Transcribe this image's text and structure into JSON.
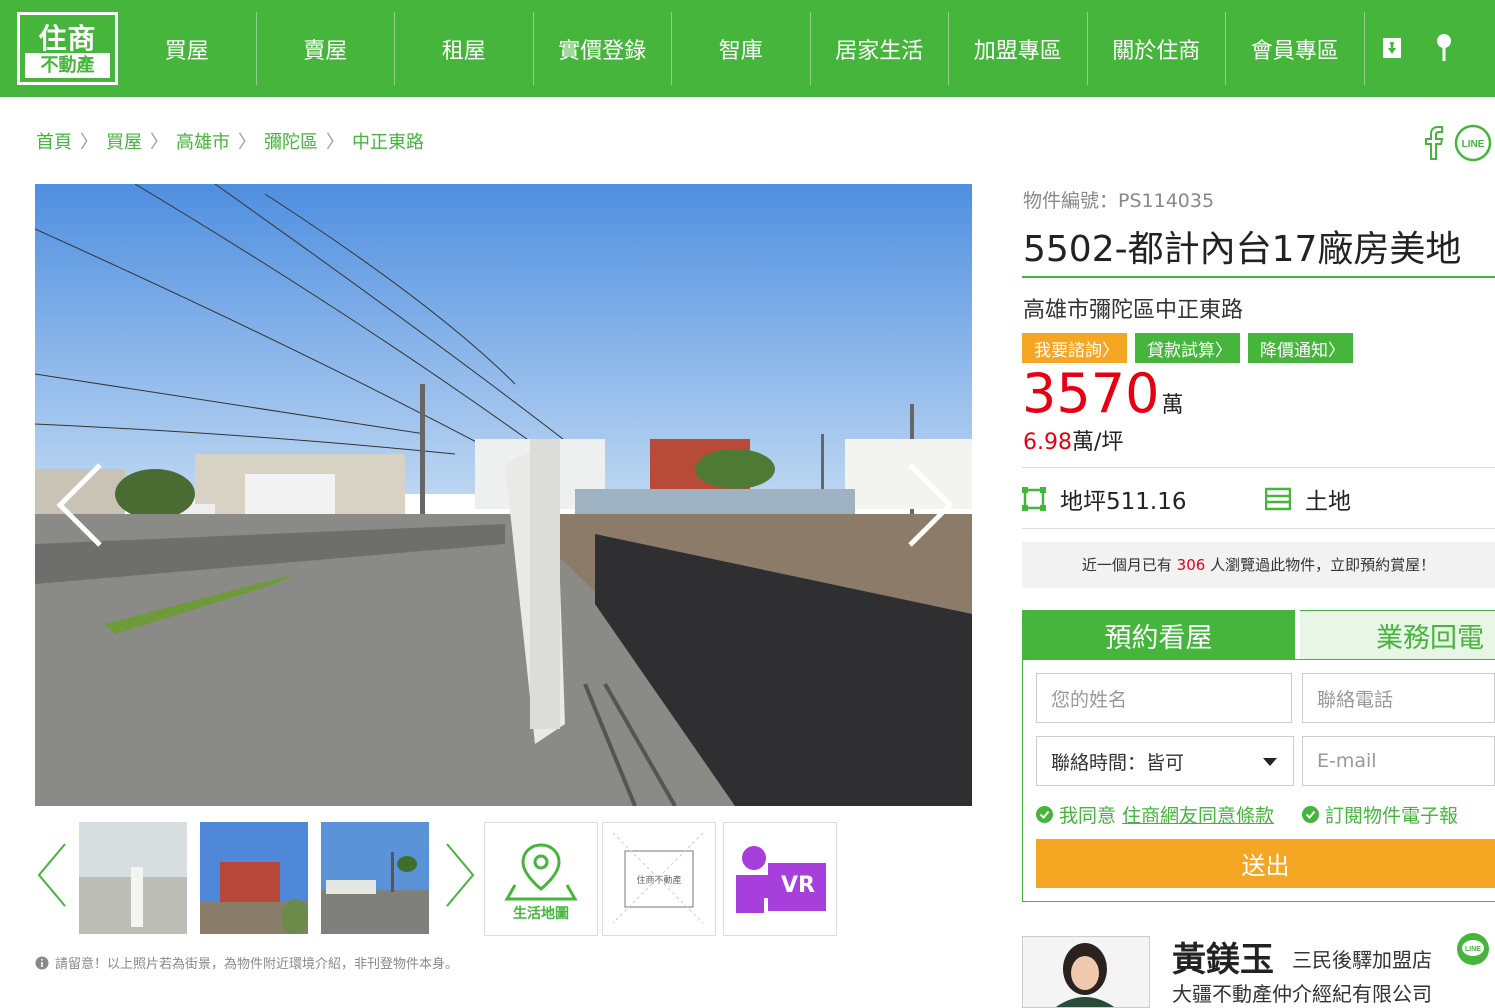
{
  "brand": {
    "logo_top": "住商",
    "logo_bottom": "不動產",
    "color": "#46b53c"
  },
  "nav": {
    "items": [
      "買屋",
      "賣屋",
      "租屋",
      "實價登錄",
      "智庫",
      "居家生活",
      "加盟專區",
      "關於住商",
      "會員專區"
    ]
  },
  "top_icons": [
    "bookmark-icon",
    "location-pin-icon"
  ],
  "breadcrumb": [
    "首頁",
    "買屋",
    "高雄市",
    "彌陀區",
    "中正東路"
  ],
  "share": [
    "facebook-icon",
    "line-icon"
  ],
  "share_line_label": "LINE",
  "gallery": {
    "tools": {
      "map_label": "生活地圖",
      "floorplan_label": "住商不動產",
      "vr_label": "VR"
    },
    "notice": "請留意！以上照片若為街景，為物件附近環境介紹，非刊登物件本身。"
  },
  "listing": {
    "code": "物件編號：PS114035",
    "title": "5502-都計內台17廠房美地",
    "address": "高雄市彌陀區中正東路",
    "tags": [
      "我要諮詢",
      "貸款試算",
      "降價通知"
    ],
    "price": "3570",
    "price_unit": "萬",
    "unit_price_value": "6.98",
    "unit_price_unit": "萬/坪",
    "land_area": "地坪511.16",
    "type": "土地",
    "views_prefix": "近一個月已有",
    "views_count": "306",
    "views_suffix": "人瀏覽過此物件，立即預約賞屋！"
  },
  "form": {
    "tab_active": "預約看屋",
    "tab_inactive": "業務回電",
    "name_placeholder": "您的姓名",
    "phone_placeholder": "聯絡電話",
    "time_value": "聯絡時間：皆可",
    "email_placeholder": "E-mail",
    "agree_prefix": "我同意",
    "agree_link": "住商網友同意條款",
    "subscribe": "訂閱物件電子報",
    "submit": "送出"
  },
  "agent": {
    "name": "黃鎂玉",
    "store": "三民後驛加盟店",
    "company": "大疆不動產仲介經紀有限公司",
    "line_label": "LINE"
  },
  "colors": {
    "green": "#46b53c",
    "orange": "#f5a623",
    "red": "#e60012"
  }
}
